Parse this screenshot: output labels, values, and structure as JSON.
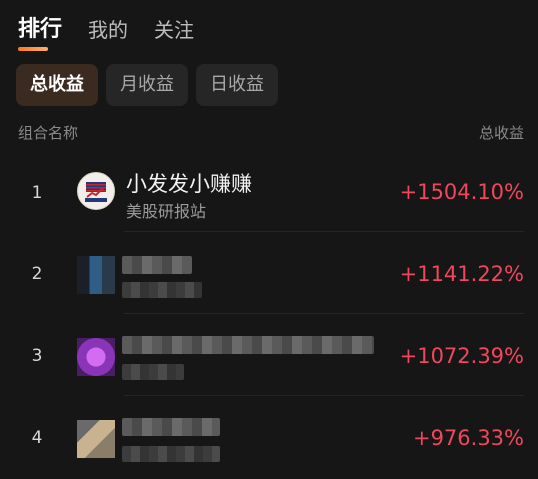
{
  "top_tabs": [
    {
      "label": "排行",
      "active": true
    },
    {
      "label": "我的",
      "active": false
    },
    {
      "label": "关注",
      "active": false
    }
  ],
  "period_chips": [
    {
      "label": "总收益",
      "active": true
    },
    {
      "label": "月收益",
      "active": false
    },
    {
      "label": "日收益",
      "active": false
    }
  ],
  "list_header": {
    "name_col": "组合名称",
    "return_col": "总收益"
  },
  "rows": [
    {
      "rank": "1",
      "title": "小发发小赚赚",
      "subtitle": "美股研报站",
      "return": "+1504.10%",
      "avatar": "logo-icon"
    },
    {
      "rank": "2",
      "title": "",
      "subtitle": "",
      "return": "+1141.22%",
      "avatar": "pixelated-avatar-icon"
    },
    {
      "rank": "3",
      "title": "",
      "subtitle": "",
      "return": "+1072.39%",
      "avatar": "pixelated-avatar-icon"
    },
    {
      "rank": "4",
      "title": "",
      "subtitle": "",
      "return": "+976.33%",
      "avatar": "pixelated-avatar-icon"
    }
  ],
  "colors": {
    "background": "#161616",
    "positive_return": "#f0475c",
    "tab_indicator": "#ff7a1a",
    "chip_active_bg": "#3a2a20"
  }
}
